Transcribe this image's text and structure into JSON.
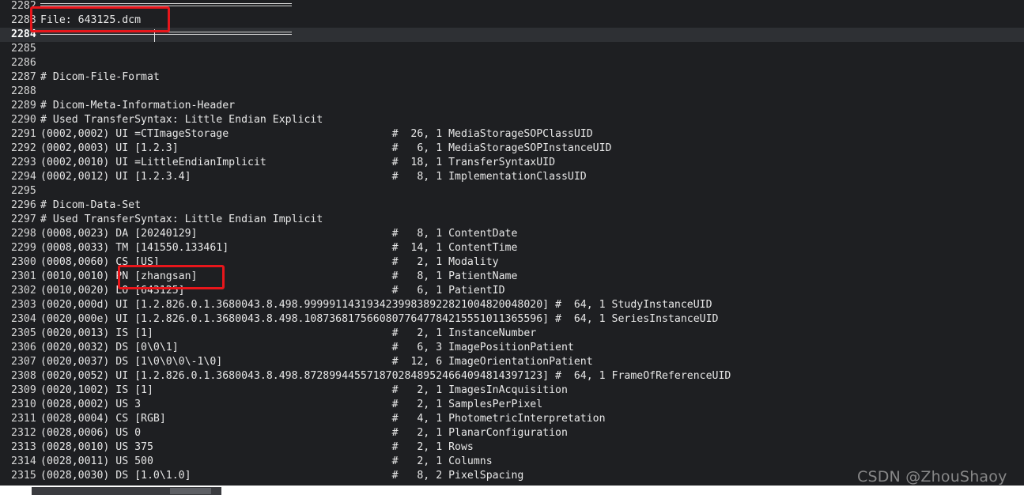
{
  "editor": {
    "cursor_line": "2284",
    "lines": [
      {
        "n": "2282",
        "text": "",
        "sep": true
      },
      {
        "n": "2283",
        "text": "File: 643125.dcm"
      },
      {
        "n": "2284",
        "text": "",
        "sep": true
      },
      {
        "n": "2285",
        "text": ""
      },
      {
        "n": "2286",
        "text": ""
      },
      {
        "n": "2287",
        "text": "# Dicom-File-Format"
      },
      {
        "n": "2288",
        "text": ""
      },
      {
        "n": "2289",
        "text": "# Dicom-Meta-Information-Header"
      },
      {
        "n": "2290",
        "text": "# Used TransferSyntax: Little Endian Explicit"
      },
      {
        "n": "2291",
        "text": "(0002,0002) UI =CTImageStorage                          #  26, 1 MediaStorageSOPClassUID"
      },
      {
        "n": "2292",
        "text": "(0002,0003) UI [1.2.3]                                  #   6, 1 MediaStorageSOPInstanceUID"
      },
      {
        "n": "2293",
        "text": "(0002,0010) UI =LittleEndianImplicit                    #  18, 1 TransferSyntaxUID"
      },
      {
        "n": "2294",
        "text": "(0002,0012) UI [1.2.3.4]                                #   8, 1 ImplementationClassUID"
      },
      {
        "n": "2295",
        "text": ""
      },
      {
        "n": "2296",
        "text": "# Dicom-Data-Set"
      },
      {
        "n": "2297",
        "text": "# Used TransferSyntax: Little Endian Implicit"
      },
      {
        "n": "2298",
        "text": "(0008,0023) DA [20240129]                               #   8, 1 ContentDate"
      },
      {
        "n": "2299",
        "text": "(0008,0033) TM [141550.133461]                          #  14, 1 ContentTime"
      },
      {
        "n": "2300",
        "text": "(0008,0060) CS [US]                                     #   2, 1 Modality"
      },
      {
        "n": "2301",
        "text": "(0010,0010) PN [zhangsan]                               #   8, 1 PatientName"
      },
      {
        "n": "2302",
        "text": "(0010,0020) LO [643125]                                 #   6, 1 PatientID"
      },
      {
        "n": "2303",
        "text": "(0020,000d) UI [1.2.826.0.1.3680043.8.498.99999114319342399838922821004820048020] #  64, 1 StudyInstanceUID"
      },
      {
        "n": "2304",
        "text": "(0020,000e) UI [1.2.826.0.1.3680043.8.498.10873681756608077647784215551011365596] #  64, 1 SeriesInstanceUID"
      },
      {
        "n": "2305",
        "text": "(0020,0013) IS [1]                                      #   2, 1 InstanceNumber"
      },
      {
        "n": "2306",
        "text": "(0020,0032) DS [0\\0\\1]                                  #   6, 3 ImagePositionPatient"
      },
      {
        "n": "2307",
        "text": "(0020,0037) DS [1\\0\\0\\0\\-1\\0]                           #  12, 6 ImageOrientationPatient"
      },
      {
        "n": "2308",
        "text": "(0020,0052) UI [1.2.826.0.1.3680043.8.498.87289944557187028489524664094814397123] #  64, 1 FrameOfReferenceUID"
      },
      {
        "n": "2309",
        "text": "(0020,1002) IS [1]                                      #   2, 1 ImagesInAcquisition"
      },
      {
        "n": "2310",
        "text": "(0028,0002) US 3                                        #   2, 1 SamplesPerPixel"
      },
      {
        "n": "2311",
        "text": "(0028,0004) CS [RGB]                                    #   4, 1 PhotometricInterpretation"
      },
      {
        "n": "2312",
        "text": "(0028,0006) US 0                                        #   2, 1 PlanarConfiguration"
      },
      {
        "n": "2313",
        "text": "(0028,0010) US 375                                      #   2, 1 Rows"
      },
      {
        "n": "2314",
        "text": "(0028,0011) US 500                                      #   2, 1 Columns"
      },
      {
        "n": "2315",
        "text": "(0028,0030) DS [1.0\\1.0]                                #   8, 2 PixelSpacing"
      }
    ]
  },
  "watermark": "CSDN @ZhouShaoy",
  "colors": {
    "background": "#1e1f22",
    "current_line": "#2e3034",
    "text": "#e8e8e8",
    "highlight_box": "#e8161b"
  }
}
